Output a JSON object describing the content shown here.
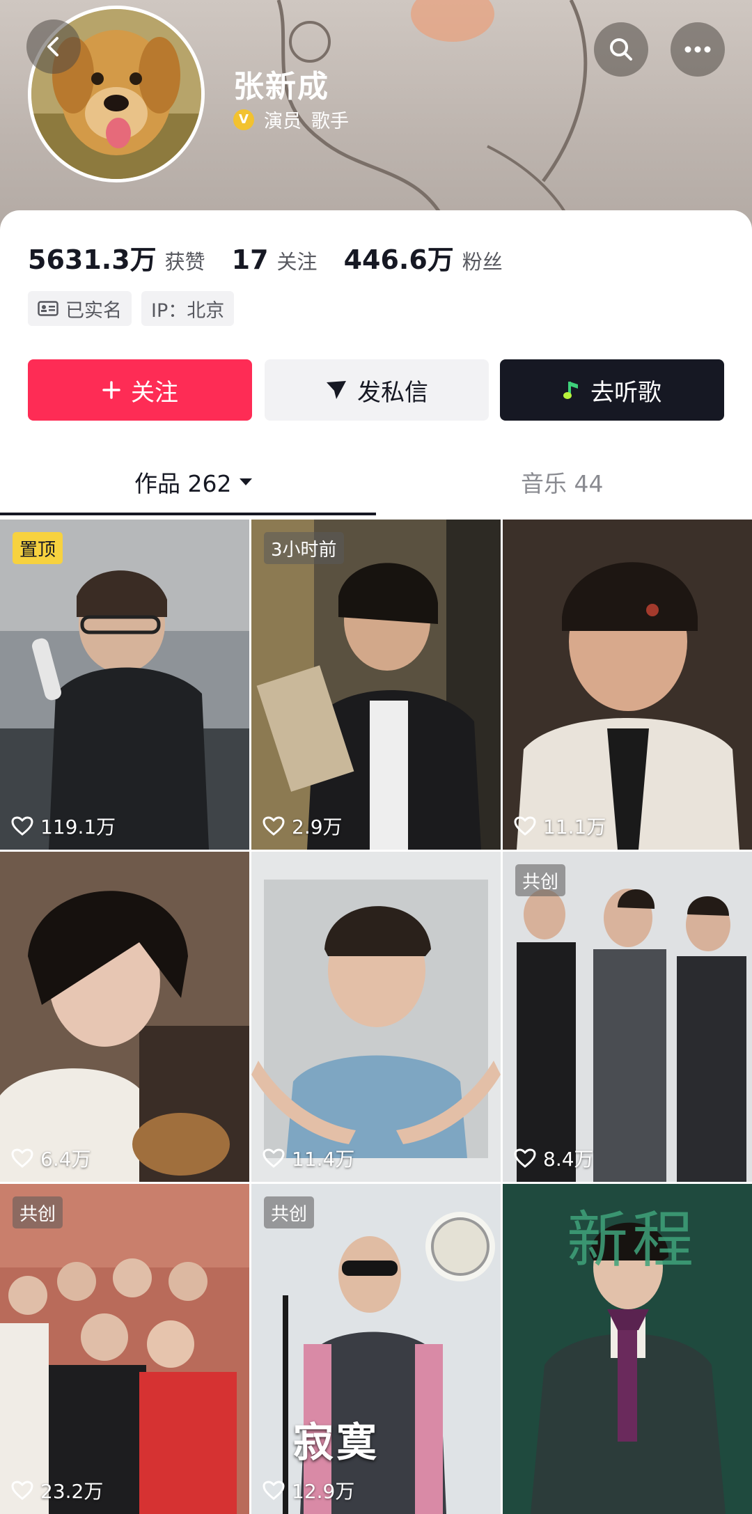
{
  "header": {
    "name": "张新成",
    "tags": [
      "演员",
      "歌手"
    ],
    "verified_mark": "V"
  },
  "stats": [
    {
      "value": "5631.3万",
      "label": "获赞"
    },
    {
      "value": "17",
      "label": "关注"
    },
    {
      "value": "446.6万",
      "label": "粉丝"
    }
  ],
  "chips": {
    "realname": "已实名",
    "ip": "IP：北京"
  },
  "actions": {
    "follow": "关注",
    "message": "发私信",
    "music": "去听歌"
  },
  "tabs": {
    "works": "作品 262",
    "music": "音乐 44"
  },
  "videos": [
    {
      "badge": "置顶",
      "likes": "119.1万"
    },
    {
      "badge": "3小时前",
      "likes": "2.9万"
    },
    {
      "badge": "",
      "likes": "11.1万"
    },
    {
      "badge": "",
      "likes": "6.4万"
    },
    {
      "badge": "",
      "likes": "11.4万"
    },
    {
      "badge": "共创",
      "likes": "8.4万"
    },
    {
      "badge": "共创",
      "likes": "23.2万"
    },
    {
      "badge": "共创",
      "likes": "12.9万",
      "title_text": "寂寞"
    },
    {
      "badge": "",
      "likes": "",
      "title_text": "新程"
    }
  ],
  "colors": {
    "follow_bg": "#fe2c55",
    "music_bg": "#161823",
    "pin_badge": "#f7d23f"
  }
}
